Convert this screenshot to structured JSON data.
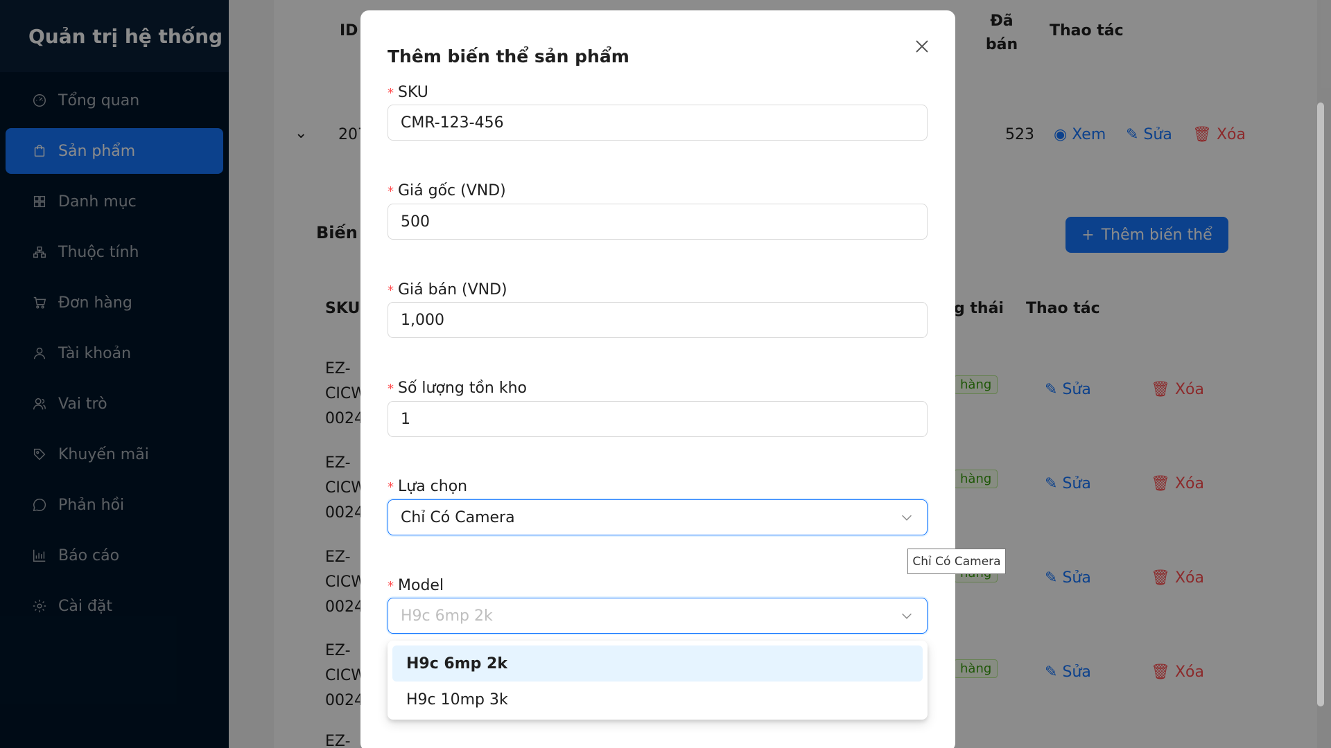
{
  "sidebar": {
    "brand": "Quản trị hệ thống",
    "items": [
      {
        "label": "Tổng quan",
        "icon": "dashboard-icon"
      },
      {
        "label": "Sản phẩm",
        "icon": "shopping-bag-icon",
        "active": true
      },
      {
        "label": "Danh mục",
        "icon": "grid-icon"
      },
      {
        "label": "Thuộc tính",
        "icon": "cluster-icon"
      },
      {
        "label": "Đơn hàng",
        "icon": "cart-icon"
      },
      {
        "label": "Tài khoản",
        "icon": "user-icon"
      },
      {
        "label": "Vai trò",
        "icon": "team-icon"
      },
      {
        "label": "Khuyến mãi",
        "icon": "tag-icon"
      },
      {
        "label": "Phản hồi",
        "icon": "message-icon"
      },
      {
        "label": "Báo cáo",
        "icon": "bar-chart-icon"
      },
      {
        "label": "Cài đặt",
        "icon": "gear-icon"
      }
    ]
  },
  "background": {
    "product_table": {
      "col_id": "ID",
      "col_sold": "Đã bán",
      "col_actions": "Thao tác",
      "row_id": "207",
      "row_sold": "523",
      "view": "Xem",
      "edit": "Sửa",
      "delete": "Xóa"
    },
    "variants": {
      "title": "Biến",
      "add_button": "Thêm biến thể",
      "col_sku": "SKU",
      "col_status": "g thái",
      "col_actions": "Thao tác",
      "rows": [
        {
          "sku1": "EZ-",
          "sku2": "CICW",
          "sku3": "0024",
          "status": "hàng",
          "edit": "Sửa",
          "delete": "Xóa"
        },
        {
          "sku1": "EZ-",
          "sku2": "CICW",
          "sku3": "0024",
          "status": "hàng",
          "edit": "Sửa",
          "delete": "Xóa"
        },
        {
          "sku1": "EZ-",
          "sku2": "CICW",
          "sku3": "0024",
          "status": "hàng",
          "edit": "Sửa",
          "delete": "Xóa"
        },
        {
          "sku1": "EZ-",
          "sku2": "CICW",
          "sku3": "0024",
          "status": "hàng",
          "edit": "Sửa",
          "delete": "Xóa"
        }
      ],
      "last_sku": "EZ-"
    }
  },
  "modal": {
    "title": "Thêm biến thể sản phẩm",
    "fields": {
      "sku": {
        "label": "SKU",
        "value": "CMR-123-456"
      },
      "original_price": {
        "label": "Giá gốc (VND)",
        "value": "500"
      },
      "sale_price": {
        "label": "Giá bán (VND)",
        "value": "1,000"
      },
      "stock": {
        "label": "Số lượng tồn kho",
        "value": "1"
      },
      "option": {
        "label": "Lựa chọn",
        "value": "Chỉ Có Camera"
      },
      "model": {
        "label": "Model",
        "placeholder": "H9c 6mp 2k"
      }
    },
    "model_options": [
      "H9c 6mp 2k",
      "H9c 10mp 3k"
    ],
    "tooltip": "Chỉ Có Camera"
  },
  "colors": {
    "primary": "#1677ff",
    "danger": "#ff4d4f",
    "sidebar_bg": "#001529"
  }
}
